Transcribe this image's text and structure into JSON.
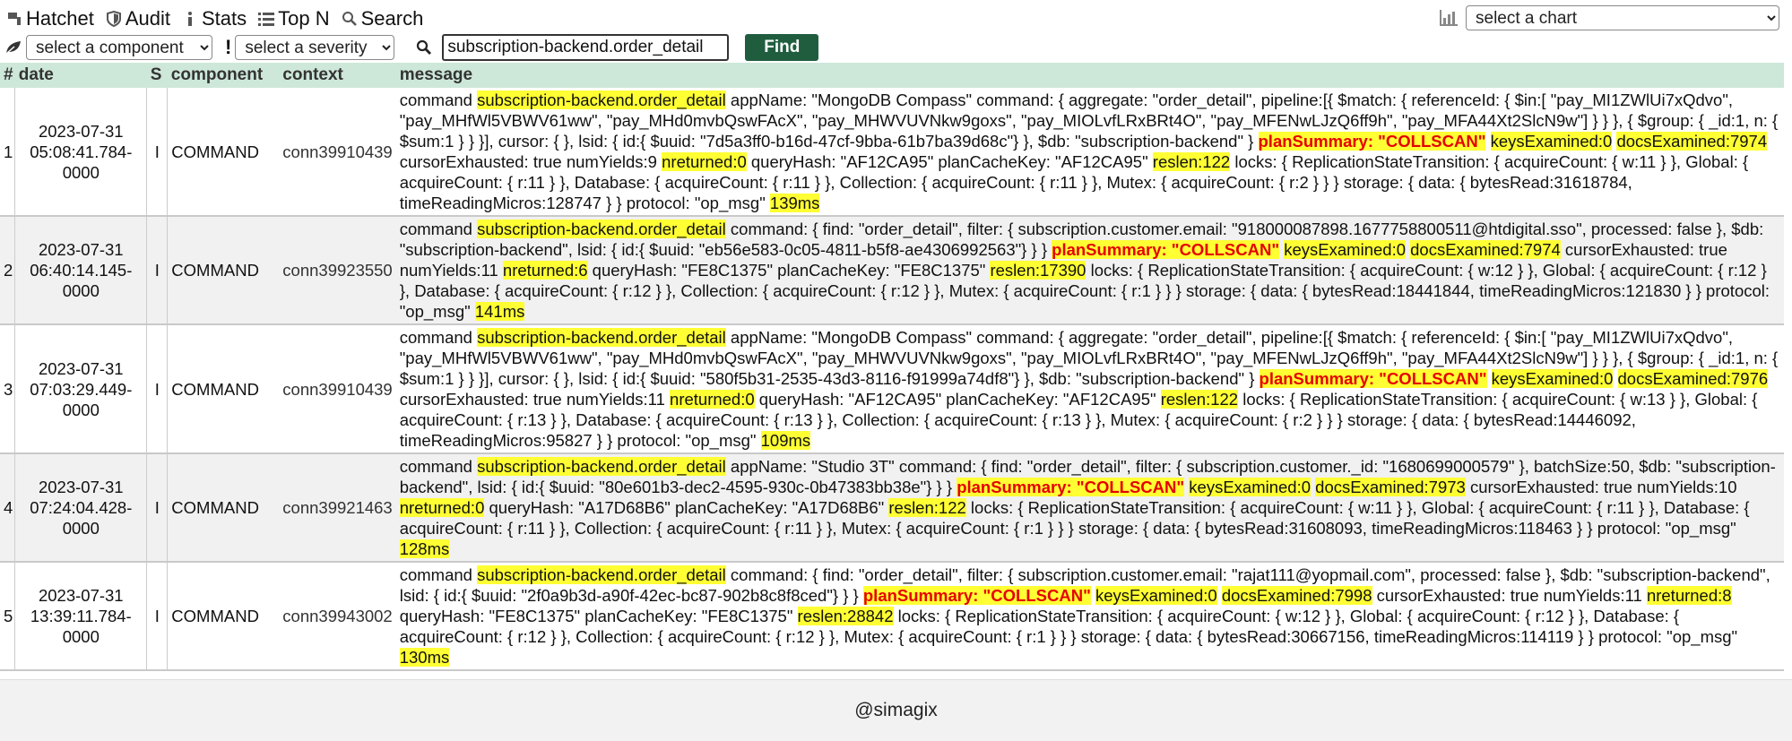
{
  "nav": {
    "hatchet": "Hatchet",
    "audit": "Audit",
    "stats": "Stats",
    "topn": "Top N",
    "search": "Search"
  },
  "chart_select": {
    "selected": "select a chart"
  },
  "filters": {
    "component_select": "select a component",
    "severity_select": "select a severity",
    "search_value": "subscription-backend.order_detail",
    "find_label": "Find"
  },
  "table": {
    "headers": {
      "num": "#",
      "date": "date",
      "severity": "S",
      "component": "component",
      "context": "context",
      "message": "message"
    },
    "rows": [
      {
        "num": "1",
        "date": "2023-07-31 05:08:41.784-0000",
        "severity": "I",
        "component": "COMMAND",
        "context": "conn39910439",
        "message": [
          {
            "t": "command "
          },
          {
            "t": "subscription-backend.order_detail",
            "h": "y"
          },
          {
            "t": " appName: \"MongoDB Compass\" command: { aggregate: \"order_detail\", pipeline:[{ $match: { referenceId: { $in:[ \"pay_MI1ZWlUi7xQdvo\", \"pay_MHfWl5VBWV61ww\", \"pay_MHd0mvbQswFAcX\", \"pay_MHWVUVNkw9goxs\", \"pay_MIOLvfLRxBRt4O\", \"pay_MFENwLJzQ6ff9h\", \"pay_MFA44Xt2SlcN9w\"] } } }, { $group: { _id:1, n: { $sum:1 } } }], cursor: { }, lsid: { id:{ $uuid: \"7d5a3ff0-b16d-47cf-9bba-61b7ba39d68c\"} }, $db: \"subscription-backend\" } "
          },
          {
            "t": "planSummary: \"COLLSCAN\"",
            "h": "r"
          },
          {
            "t": " "
          },
          {
            "t": "keysExamined:0",
            "h": "y"
          },
          {
            "t": " "
          },
          {
            "t": "docsExamined:7974",
            "h": "y"
          },
          {
            "t": " cursorExhausted: true numYields:9 "
          },
          {
            "t": "nreturned:0",
            "h": "y"
          },
          {
            "t": " queryHash: \"AF12CA95\" planCacheKey: \"AF12CA95\" "
          },
          {
            "t": "reslen:122",
            "h": "y"
          },
          {
            "t": " locks: { ReplicationStateTransition: { acquireCount: { w:11 } }, Global: { acquireCount: { r:11 } }, Database: { acquireCount: { r:11 } }, Collection: { acquireCount: { r:11 } }, Mutex: { acquireCount: { r:2 } } } storage: { data: { bytesRead:31618784, timeReadingMicros:128747 } } protocol: \"op_msg\" "
          },
          {
            "t": "139ms",
            "h": "y"
          }
        ]
      },
      {
        "num": "2",
        "date": "2023-07-31 06:40:14.145-0000",
        "severity": "I",
        "component": "COMMAND",
        "context": "conn39923550",
        "message": [
          {
            "t": "command "
          },
          {
            "t": "subscription-backend.order_detail",
            "h": "y"
          },
          {
            "t": " command: { find: \"order_detail\", filter: { subscription.customer.email: \"918000087898.1677758800511@htdigital.sso\", processed: false }, $db: \"subscription-backend\", lsid: { id:{ $uuid: \"eb56e583-0c05-4811-b5f8-ae4306992563\"} } } "
          },
          {
            "t": "planSummary: \"COLLSCAN\"",
            "h": "r"
          },
          {
            "t": " "
          },
          {
            "t": "keysExamined:0",
            "h": "y"
          },
          {
            "t": " "
          },
          {
            "t": "docsExamined:7974",
            "h": "y"
          },
          {
            "t": " cursorExhausted: true numYields:11 "
          },
          {
            "t": "nreturned:6",
            "h": "y"
          },
          {
            "t": " queryHash: \"FE8C1375\" planCacheKey: \"FE8C1375\" "
          },
          {
            "t": "reslen:17390",
            "h": "y"
          },
          {
            "t": " locks: { ReplicationStateTransition: { acquireCount: { w:12 } }, Global: { acquireCount: { r:12 } }, Database: { acquireCount: { r:12 } }, Collection: { acquireCount: { r:12 } }, Mutex: { acquireCount: { r:1 } } } storage: { data: { bytesRead:18441844, timeReadingMicros:121830 } } protocol: \"op_msg\" "
          },
          {
            "t": "141ms",
            "h": "y"
          }
        ]
      },
      {
        "num": "3",
        "date": "2023-07-31 07:03:29.449-0000",
        "severity": "I",
        "component": "COMMAND",
        "context": "conn39910439",
        "message": [
          {
            "t": "command "
          },
          {
            "t": "subscription-backend.order_detail",
            "h": "y"
          },
          {
            "t": " appName: \"MongoDB Compass\" command: { aggregate: \"order_detail\", pipeline:[{ $match: { referenceId: { $in:[ \"pay_MI1ZWlUi7xQdvo\", \"pay_MHfWl5VBWV61ww\", \"pay_MHd0mvbQswFAcX\", \"pay_MHWVUVNkw9goxs\", \"pay_MIOLvfLRxBRt4O\", \"pay_MFENwLJzQ6ff9h\", \"pay_MFA44Xt2SlcN9w\"] } } }, { $group: { _id:1, n: { $sum:1 } } }], cursor: { }, lsid: { id:{ $uuid: \"580f5b31-2535-43d3-8116-f91999a74df8\"} }, $db: \"subscription-backend\" } "
          },
          {
            "t": "planSummary: \"COLLSCAN\"",
            "h": "r"
          },
          {
            "t": " "
          },
          {
            "t": "keysExamined:0",
            "h": "y"
          },
          {
            "t": " "
          },
          {
            "t": "docsExamined:7976",
            "h": "y"
          },
          {
            "t": " cursorExhausted: true numYields:11 "
          },
          {
            "t": "nreturned:0",
            "h": "y"
          },
          {
            "t": " queryHash: \"AF12CA95\" planCacheKey: \"AF12CA95\" "
          },
          {
            "t": "reslen:122",
            "h": "y"
          },
          {
            "t": " locks: { ReplicationStateTransition: { acquireCount: { w:13 } }, Global: { acquireCount: { r:13 } }, Database: { acquireCount: { r:13 } }, Collection: { acquireCount: { r:13 } }, Mutex: { acquireCount: { r:2 } } } storage: { data: { bytesRead:14446092, timeReadingMicros:95827 } } protocol: \"op_msg\" "
          },
          {
            "t": "109ms",
            "h": "y"
          }
        ]
      },
      {
        "num": "4",
        "date": "2023-07-31 07:24:04.428-0000",
        "severity": "I",
        "component": "COMMAND",
        "context": "conn39921463",
        "message": [
          {
            "t": "command "
          },
          {
            "t": "subscription-backend.order_detail",
            "h": "y"
          },
          {
            "t": " appName: \"Studio 3T\" command: { find: \"order_detail\", filter: { subscription.customer._id: \"1680699000579\" }, batchSize:50, $db: \"subscription-backend\", lsid: { id:{ $uuid: \"80e601b3-dec2-4595-930c-0b47383bb38e\"} } } "
          },
          {
            "t": "planSummary: \"COLLSCAN\"",
            "h": "r"
          },
          {
            "t": " "
          },
          {
            "t": "keysExamined:0",
            "h": "y"
          },
          {
            "t": " "
          },
          {
            "t": "docsExamined:7973",
            "h": "y"
          },
          {
            "t": " cursorExhausted: true numYields:10 "
          },
          {
            "t": "nreturned:0",
            "h": "y"
          },
          {
            "t": " queryHash: \"A17D68B6\" planCacheKey: \"A17D68B6\" "
          },
          {
            "t": "reslen:122",
            "h": "y"
          },
          {
            "t": " locks: { ReplicationStateTransition: { acquireCount: { w:11 } }, Global: { acquireCount: { r:11 } }, Database: { acquireCount: { r:11 } }, Collection: { acquireCount: { r:11 } }, Mutex: { acquireCount: { r:1 } } } storage: { data: { bytesRead:31608093, timeReadingMicros:118463 } } protocol: \"op_msg\" "
          },
          {
            "t": "128ms",
            "h": "y"
          }
        ]
      },
      {
        "num": "5",
        "date": "2023-07-31 13:39:11.784-0000",
        "severity": "I",
        "component": "COMMAND",
        "context": "conn39943002",
        "message": [
          {
            "t": "command "
          },
          {
            "t": "subscription-backend.order_detail",
            "h": "y"
          },
          {
            "t": " command: { find: \"order_detail\", filter: { subscription.customer.email: \"rajat111@yopmail.com\", processed: false }, $db: \"subscription-backend\", lsid: { id:{ $uuid: \"2f0a9b3d-a90f-42ec-bc87-902b8c8f8ced\"} } } "
          },
          {
            "t": "planSummary: \"COLLSCAN\"",
            "h": "r"
          },
          {
            "t": " "
          },
          {
            "t": "keysExamined:0",
            "h": "y"
          },
          {
            "t": " "
          },
          {
            "t": "docsExamined:7998",
            "h": "y"
          },
          {
            "t": " cursorExhausted: true numYields:11 "
          },
          {
            "t": "nreturned:8",
            "h": "y"
          },
          {
            "t": " queryHash: \"FE8C1375\" planCacheKey: \"FE8C1375\" "
          },
          {
            "t": "reslen:28842",
            "h": "y"
          },
          {
            "t": " locks: { ReplicationStateTransition: { acquireCount: { w:12 } }, Global: { acquireCount: { r:12 } }, Database: { acquireCount: { r:12 } }, Collection: { acquireCount: { r:12 } }, Mutex: { acquireCount: { r:1 } } } storage: { data: { bytesRead:30667156, timeReadingMicros:114119 } } protocol: \"op_msg\" "
          },
          {
            "t": "130ms",
            "h": "y"
          }
        ]
      }
    ]
  },
  "footer": {
    "text": "@simagix"
  },
  "colors": {
    "header_bg": "#cde7d9",
    "highlight": "#ffff33",
    "collscan_text": "#e60000",
    "find_button": "#1f5d3e"
  }
}
